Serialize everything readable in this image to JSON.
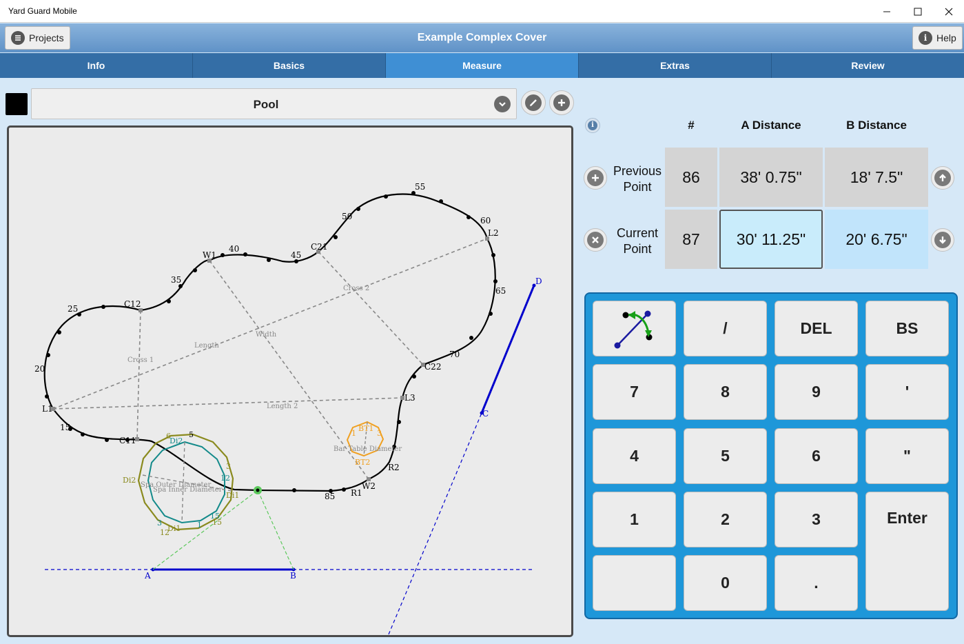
{
  "window": {
    "title": "Yard Guard Mobile",
    "minimize_icon": "minimize-icon",
    "maximize_icon": "maximize-icon",
    "close_icon": "close-icon"
  },
  "header": {
    "title": "Example Complex Cover",
    "projects_label": "Projects",
    "help_label": "Help"
  },
  "tabs": [
    {
      "label": "Info",
      "active": false
    },
    {
      "label": "Basics",
      "active": false
    },
    {
      "label": "Measure",
      "active": true
    },
    {
      "label": "Extras",
      "active": false
    },
    {
      "label": "Review",
      "active": false
    }
  ],
  "layer": {
    "color": "#000000",
    "selected": "Pool"
  },
  "table": {
    "headers": {
      "num": "#",
      "a": "A Distance",
      "b": "B Distance"
    },
    "previous": {
      "label_line1": "Previous",
      "label_line2": "Point",
      "num": "86",
      "a": "38' 0.75\"",
      "b": "18' 7.5\""
    },
    "current": {
      "label_line1": "Current",
      "label_line2": "Point",
      "num": "87",
      "a": "30' 11.25\"",
      "b": "20' 6.75\""
    }
  },
  "keypad": {
    "keys": [
      "/",
      "DEL",
      "BS",
      "7",
      "8",
      "9",
      "'",
      "4",
      "5",
      "6",
      "\"",
      "1",
      "2",
      "3",
      "Enter",
      "",
      "0",
      "."
    ]
  },
  "drawing": {
    "pool_labels": [
      "55",
      "50",
      "60",
      "L2",
      "C21",
      "45",
      "40",
      "W1",
      "35",
      "65",
      "C12",
      "25",
      "Cross 2",
      "Length",
      "Width",
      "Cross 1",
      "20",
      "70",
      "C22",
      "L3",
      "L1",
      "Length 2",
      "15",
      "C11",
      "85",
      "R1",
      "W2",
      "R2"
    ],
    "spa_labels": [
      "6",
      "5",
      "Di2",
      "3",
      "12",
      "Di2",
      "Di1",
      "3",
      "1",
      "15",
      "12",
      "Di1",
      "15",
      "Spa Outer Diameter",
      "Spa Inner Diameter"
    ],
    "table_labels": [
      "BT1",
      "1",
      "3",
      "Bar Table Diameter",
      "BT2"
    ],
    "reference_labels": [
      "A",
      "B",
      "C",
      "D"
    ],
    "colors": {
      "pool": "#000000",
      "guide": "#888888",
      "spa_outer": "#8a8a1e",
      "spa_inner": "#138a8a",
      "bar_table": "#f0a020",
      "reference": "#0000cc",
      "measure_lines": "#5cc85c"
    }
  }
}
